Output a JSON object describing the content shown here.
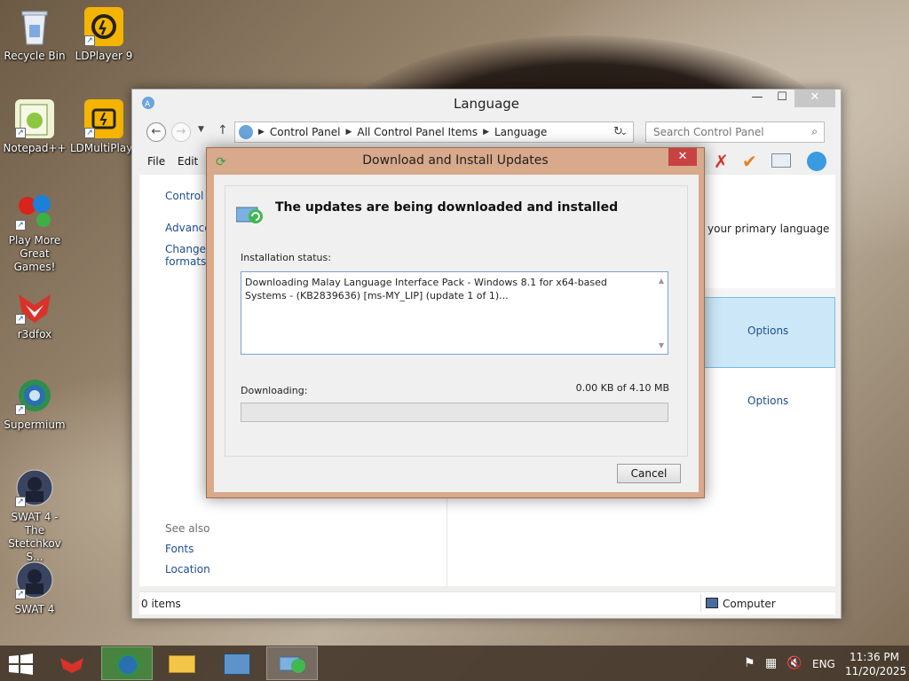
{
  "desktop": {
    "icons": [
      {
        "label": "Recycle Bin"
      },
      {
        "label": "LDPlayer 9"
      },
      {
        "label": "Notepad++"
      },
      {
        "label": "LDMultiPlayer"
      },
      {
        "label": "Play More Great Games!"
      },
      {
        "label": "r3dfox"
      },
      {
        "label": "Supermium"
      },
      {
        "label": "SWAT 4 - The Stetchkov S..."
      },
      {
        "label": "SWAT 4"
      }
    ]
  },
  "window": {
    "title": "Language",
    "address": [
      "Control Panel",
      "All Control Panel Items",
      "Language"
    ],
    "search_placeholder": "Search Control Panel",
    "menu": [
      "File",
      "Edit"
    ],
    "left_links": {
      "control_panel_home": "Control P",
      "advanced": "Advance",
      "change": "Change d",
      "formats": "formats"
    },
    "see_also": "See also",
    "see_also_links": [
      "Fonts",
      "Location"
    ],
    "right_text": "your primary language",
    "options_links": [
      "Options",
      "Options"
    ],
    "status_items": "0 items",
    "status_zone": "Computer",
    "toolbar_icons": [
      "red-x-icon",
      "check-icon",
      "keyboard-icon",
      "globe-icon"
    ]
  },
  "dialog": {
    "title": "Download and Install Updates",
    "heading": "The updates are being downloaded and installed",
    "status_label": "Installation status:",
    "status_text": "Downloading Malay Language Interface Pack - Windows 8.1 for x64-based Systems - (KB2839636) [ms-MY_LIP] (update 1 of 1)...",
    "downloading_label": "Downloading:",
    "progress_text": "0.00 KB of 4.10 MB",
    "progress_fraction": 0.0,
    "cancel_label": "Cancel"
  },
  "taskbar": {
    "lang": "ENG",
    "time": "11:36 PM",
    "date": "11/20/2025"
  }
}
